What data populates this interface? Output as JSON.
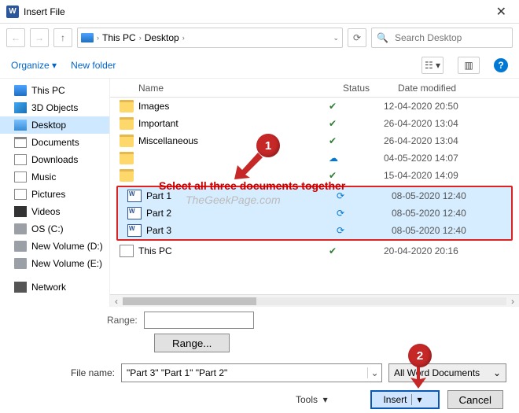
{
  "title": "Insert File",
  "breadcrumb": {
    "root": "This PC",
    "loc": "Desktop"
  },
  "search": {
    "placeholder": "Search Desktop"
  },
  "toolbar": {
    "organize": "Organize",
    "newfolder": "New folder"
  },
  "columns": {
    "name": "Name",
    "status": "Status",
    "date": "Date modified"
  },
  "sidebar": [
    {
      "label": "This PC",
      "cls": "ic-pc"
    },
    {
      "label": "3D Objects",
      "cls": "ic-3d"
    },
    {
      "label": "Desktop",
      "cls": "ic-desk",
      "active": true
    },
    {
      "label": "Documents",
      "cls": "ic-doc"
    },
    {
      "label": "Downloads",
      "cls": "ic-dl"
    },
    {
      "label": "Music",
      "cls": "ic-music"
    },
    {
      "label": "Pictures",
      "cls": "ic-pic"
    },
    {
      "label": "Videos",
      "cls": "ic-vid"
    },
    {
      "label": "OS (C:)",
      "cls": "ic-drive"
    },
    {
      "label": "New Volume (D:)",
      "cls": "ic-drive"
    },
    {
      "label": "New Volume (E:)",
      "cls": "ic-drive"
    },
    {
      "label": "Network",
      "cls": "ic-net",
      "gap": true
    }
  ],
  "files_top": [
    {
      "name": "Images",
      "type": "folder",
      "status": "ok",
      "date": "12-04-2020 20:50"
    },
    {
      "name": "Important",
      "type": "folder",
      "status": "ok",
      "date": "26-04-2020 13:04"
    },
    {
      "name": "Miscellaneous",
      "type": "folder",
      "status": "ok",
      "date": "26-04-2020 13:04"
    },
    {
      "name": "",
      "type": "folder",
      "status": "cloud",
      "date": "04-05-2020 14:07"
    },
    {
      "name": "",
      "type": "folder",
      "status": "ok",
      "date": "15-04-2020 14:09"
    }
  ],
  "files_sel": [
    {
      "name": "Part 1",
      "type": "word",
      "status": "sync",
      "date": "08-05-2020 12:40"
    },
    {
      "name": "Part 2",
      "type": "word",
      "status": "sync",
      "date": "08-05-2020 12:40"
    },
    {
      "name": "Part 3",
      "type": "word",
      "status": "sync",
      "date": "08-05-2020 12:40"
    }
  ],
  "files_bot": [
    {
      "name": "This PC",
      "type": "shortcut",
      "status": "ok",
      "date": "20-04-2020 20:16"
    }
  ],
  "annotation": {
    "callout1": "1",
    "callout2": "2",
    "text": "Select all three documents together",
    "watermark": "TheGeekPage.com"
  },
  "range": {
    "label": "Range:",
    "button": "Range..."
  },
  "filename": {
    "label": "File name:",
    "value": "\"Part 3\" \"Part 1\" \"Part 2\"",
    "filter": "All Word Documents"
  },
  "actions": {
    "tools": "Tools",
    "insert": "Insert",
    "cancel": "Cancel"
  }
}
